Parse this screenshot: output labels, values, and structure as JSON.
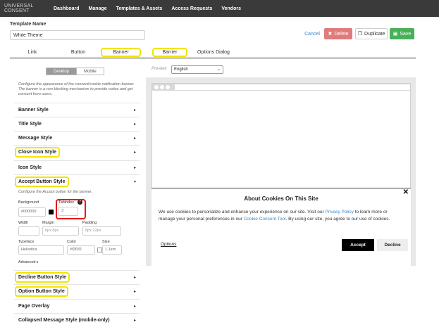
{
  "nav": {
    "brand": "UNIVERSAL CONSENT",
    "items": [
      "Dashboard",
      "Manage",
      "Templates & Assets",
      "Access Requests",
      "Vendors"
    ]
  },
  "template": {
    "label": "Template Name",
    "value": "White Theme"
  },
  "actions": {
    "cancel": "Cancel",
    "delete": "Delete",
    "duplicate": "Duplicate",
    "save": "Save"
  },
  "tabs": [
    "Link",
    "Button",
    "Banner",
    "Barrier",
    "Options Dialog"
  ],
  "device_toggle": {
    "desktop": "Desktop",
    "mobile": "Mobile"
  },
  "description": "Configure the appearance of the consent/cookie notification banner. The banner is a non-blocking mechanism to provide notice and get consent from users.",
  "sections": {
    "banner_style": "Banner Style",
    "title_style": "Title Style",
    "message_style": "Message Style",
    "close_icon_style": "Close Icon Style",
    "icon_style": "Icon Style",
    "accept_button_style": "Accept Button Style",
    "decline_button_style": "Decline Button Style",
    "option_button_style": "Option Button Style",
    "page_overlay": "Page Overlay",
    "collapsed_message_style": "Collapsed Message Style (mobile-only)"
  },
  "accept_config": {
    "desc": "Configure the Accept button for the banner.",
    "background_label": "Background",
    "background_value": "#000000",
    "tabindex_label": "Tabindex",
    "tabindex_value": "3",
    "width_label": "Width",
    "margin_label": "Margin",
    "margin_placeholder": "6px 8px",
    "padding_label": "Padding",
    "padding_placeholder": "8px 22px",
    "typeface_label": "Typeface",
    "typeface_value": "Helvetica",
    "color_label": "Color",
    "color_value": "#f2f2f2",
    "size_label": "Size",
    "size_value": "1.1em",
    "advanced": "Advanced"
  },
  "preview": {
    "label": "Preview",
    "language": "English",
    "banner": {
      "title": "About Cookies On This Site",
      "body_1": "We use cookies to personalize and enhance your experience on our site. Visit our ",
      "link_privacy": "Privacy Policy",
      "body_2": " to learn more or manage your personal preferences in our ",
      "link_tool": "Cookie Consent Tool",
      "body_3": ". By using our site, you agree to our use of cookies.",
      "options": "Options",
      "accept": "Accept",
      "decline": "Decline"
    }
  },
  "colors": {
    "highlight": "#f2e400",
    "red_highlight": "#e21b1b",
    "save_green": "#49b05a",
    "delete_red": "#e07b7b",
    "link_blue": "#3a87c8"
  }
}
